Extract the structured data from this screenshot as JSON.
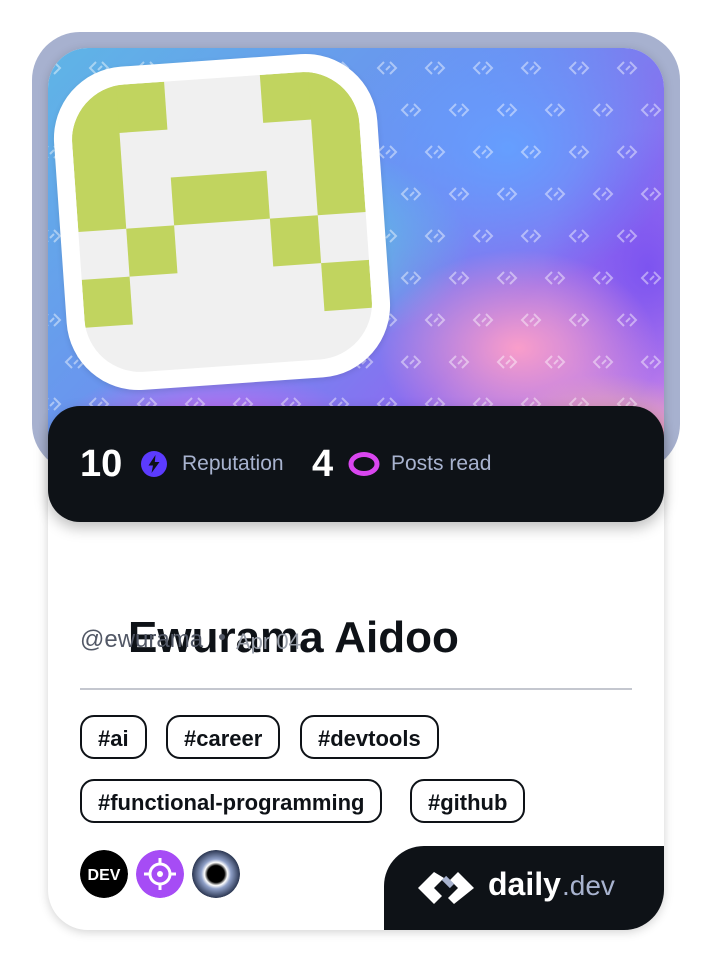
{
  "stats": {
    "reputation_value": "10",
    "reputation_label": "Reputation",
    "reputation_icon": "lightning-icon",
    "reputation_color": "#5c3bfe",
    "posts_value": "4",
    "posts_label": "Posts read",
    "posts_icon": "eye-icon",
    "posts_color": "#d946ef"
  },
  "profile": {
    "name": "Ewurama Aidoo",
    "handle": "@ewurama",
    "joined": "Apr 04",
    "avatar_color": "#c1d45f",
    "avatar_bg": "#f0f0f0"
  },
  "tags": [
    "#ai",
    "#career",
    "#devtools",
    "#functional-programming",
    "#github"
  ],
  "sources": [
    {
      "name": "DEV",
      "icon": "dev-logo-icon"
    },
    {
      "name": "",
      "icon": "crosshair-icon",
      "color": "#a64cf5"
    },
    {
      "name": "",
      "icon": "black-hole-icon"
    }
  ],
  "brand": {
    "word": "daily",
    "suffix": ".dev",
    "icon": "daily-dev-logo-icon"
  },
  "colors": {
    "frame": "#a7b1cf",
    "dark": "#0e1217",
    "muted": "#a8b3cf"
  }
}
